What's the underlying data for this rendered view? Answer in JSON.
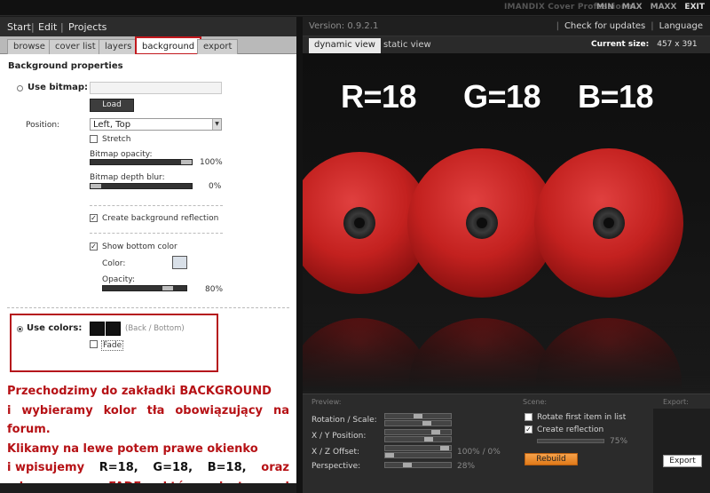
{
  "window": {
    "app_title": "IMANDIX Cover Professional",
    "controls": [
      "MIN",
      "MAX",
      "MAXX",
      "EXIT"
    ]
  },
  "left": {
    "menu": [
      "Start",
      "Edit",
      "Projects"
    ],
    "tabs": [
      "browse",
      "cover list",
      "layers",
      "background",
      "export"
    ],
    "active_tab": "background",
    "section_title": "Background properties",
    "use_bitmap": {
      "label": "Use bitmap:",
      "load_button": "Load",
      "position_label": "Position:",
      "position_value": "Left, Top",
      "stretch_label": "Stretch",
      "opacity_label": "Bitmap opacity:",
      "opacity_value": 100,
      "opacity_text": "100%",
      "depth_blur_label": "Bitmap depth blur:",
      "depth_blur_value": 0,
      "depth_blur_text": "0%"
    },
    "reflection": {
      "create_label": "Create background reflection",
      "show_bottom_label": "Show bottom color",
      "color_label": "Color:",
      "color_value": "#d9e0e8",
      "opacity_label": "Opacity:",
      "opacity_value": 80,
      "opacity_text": "80%"
    },
    "use_colors": {
      "label": "Use colors:",
      "hint": "(Back / Bottom)",
      "back_color": "#121212",
      "bottom_color": "#121212",
      "fade_label": "Fade"
    },
    "instruction": {
      "line1": "Przechodzimy do zakładki BACKGROUND",
      "line2": "i wybieramy kolor tła obowiązujący na forum.",
      "line3": "Klikamy na lewe potem prawe okienko",
      "line4a": "i wpisujemy",
      "line4b": "R=18,",
      "line4c": "G=18,",
      "line4d": "B=18,",
      "line4e": "oraz",
      "line5": "odznaczamy FADE które jest pod kwadratem."
    }
  },
  "right": {
    "version": "Version: 0.9.2.1",
    "links": [
      "Check for updates",
      "Language"
    ],
    "tabs": [
      "dynamic view",
      "static view"
    ],
    "active_tab": "dynamic view",
    "current_size_label": "Current size:",
    "current_size_value": "457 x 391",
    "overlay": {
      "r": "R=18",
      "g": "G=18",
      "b": "B=18"
    },
    "disc_color": "#c8262a",
    "controls": {
      "preview_title": "Preview:",
      "scene_title": "Scene:",
      "export_title": "Export:",
      "rotation_label": "Rotation / Scale:",
      "xy_label": "X / Y Position:",
      "xz_label": "X / Z Offset:",
      "xz_text": "100% / 0%",
      "perspective_label": "Perspective:",
      "perspective_text": "28%",
      "rotate_first_label": "Rotate first item in list",
      "create_reflection_label": "Create reflection",
      "reflection_text": "75%",
      "rebuild_label": "Rebuild",
      "export_label": "Export"
    }
  }
}
